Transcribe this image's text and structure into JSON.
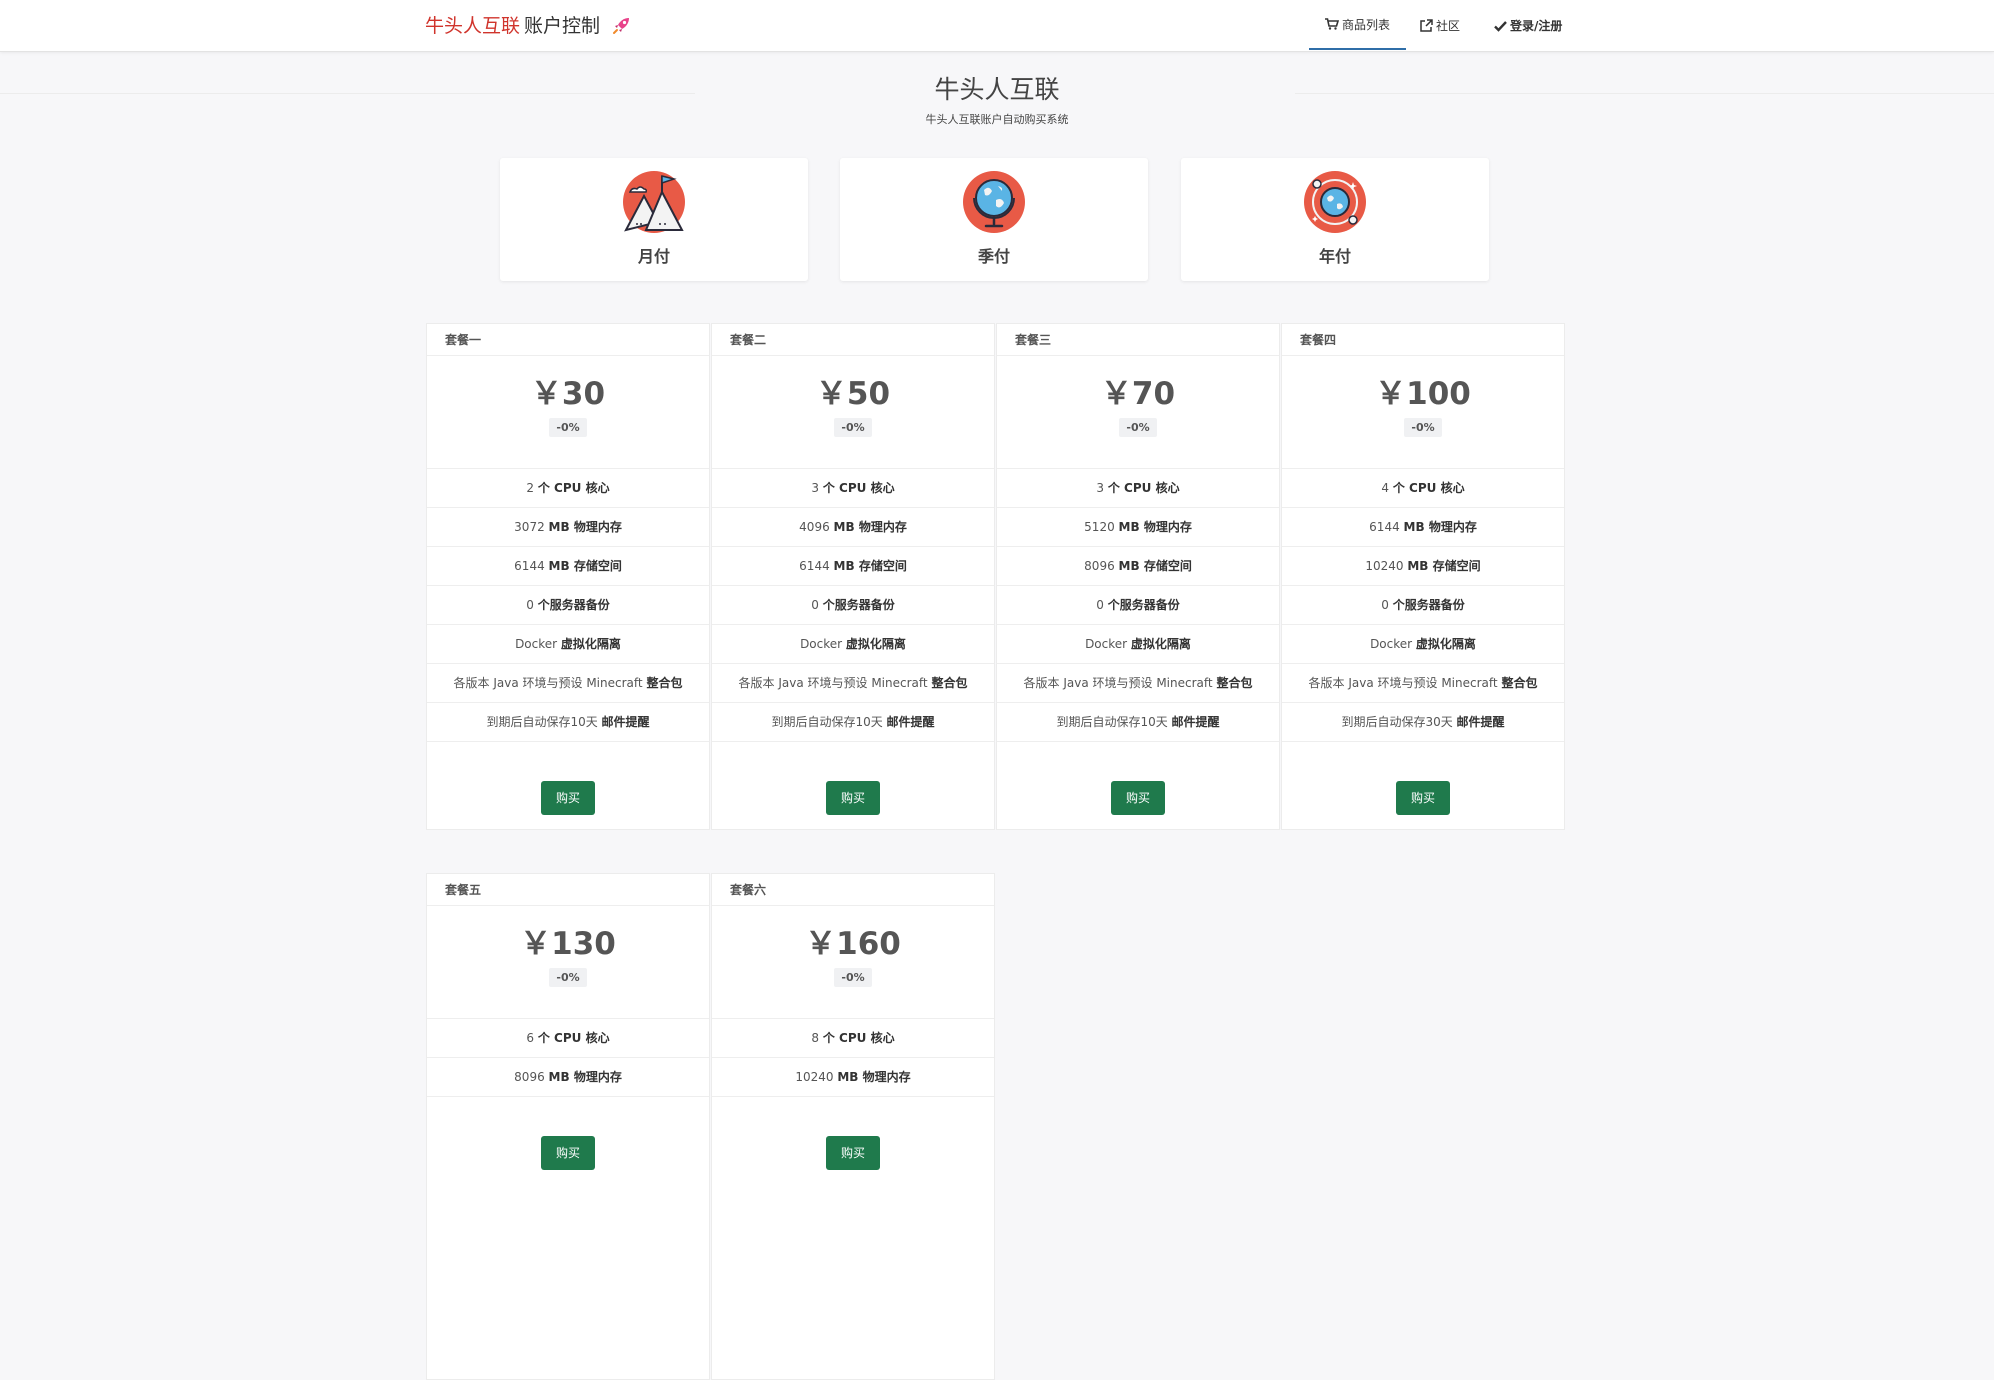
{
  "brand": {
    "name": "牛头人互联",
    "suffix": "账户控制",
    "icon": "rocket-icon",
    "color": "#d0342c"
  },
  "nav": {
    "items": [
      {
        "label": "商品列表",
        "icon": "shopping-cart-icon",
        "active": true
      },
      {
        "label": "社区",
        "icon": "external-link-icon",
        "active": false
      },
      {
        "label": "登录/注册",
        "icon": "check-icon",
        "active": false
      }
    ],
    "active_color": "#2f6ea8"
  },
  "hero": {
    "title": "牛头人互联",
    "subtitle": "牛头人互联账户自动购买系统"
  },
  "periods": [
    {
      "label": "月付",
      "icon": "mountains-flag-icon"
    },
    {
      "label": "季付",
      "icon": "globe-stand-icon"
    },
    {
      "label": "年付",
      "icon": "globe-orbit-icon"
    }
  ],
  "buy_color": "#1f7a4c",
  "plans": [
    {
      "name": "套餐一",
      "price": "￥30",
      "discount": "-0%",
      "features": [
        {
          "value": "2",
          "text": "个 CPU 核心"
        },
        {
          "value": "3072",
          "text": "MB 物理内存"
        },
        {
          "value": "6144",
          "text": "MB 存储空间"
        },
        {
          "value": "0",
          "text": "个服务器备份"
        },
        {
          "value": "Docker",
          "text": "虚拟化隔离"
        },
        {
          "value": "各版本 Java 环境与预设 Minecraft",
          "text": "整合包"
        },
        {
          "value": "到期后自动保存10天",
          "text": "邮件提醒"
        }
      ],
      "buy": "购买"
    },
    {
      "name": "套餐二",
      "price": "￥50",
      "discount": "-0%",
      "features": [
        {
          "value": "3",
          "text": "个 CPU 核心"
        },
        {
          "value": "4096",
          "text": "MB 物理内存"
        },
        {
          "value": "6144",
          "text": "MB 存储空间"
        },
        {
          "value": "0",
          "text": "个服务器备份"
        },
        {
          "value": "Docker",
          "text": "虚拟化隔离"
        },
        {
          "value": "各版本 Java 环境与预设 Minecraft",
          "text": "整合包"
        },
        {
          "value": "到期后自动保存10天",
          "text": "邮件提醒"
        }
      ],
      "buy": "购买"
    },
    {
      "name": "套餐三",
      "price": "￥70",
      "discount": "-0%",
      "features": [
        {
          "value": "3",
          "text": "个 CPU 核心"
        },
        {
          "value": "5120",
          "text": "MB 物理内存"
        },
        {
          "value": "8096",
          "text": "MB 存储空间"
        },
        {
          "value": "0",
          "text": "个服务器备份"
        },
        {
          "value": "Docker",
          "text": "虚拟化隔离"
        },
        {
          "value": "各版本 Java 环境与预设 Minecraft",
          "text": "整合包"
        },
        {
          "value": "到期后自动保存10天",
          "text": "邮件提醒"
        }
      ],
      "buy": "购买"
    },
    {
      "name": "套餐四",
      "price": "￥100",
      "discount": "-0%",
      "features": [
        {
          "value": "4",
          "text": "个 CPU 核心"
        },
        {
          "value": "6144",
          "text": "MB 物理内存"
        },
        {
          "value": "10240",
          "text": "MB 存储空间"
        },
        {
          "value": "0",
          "text": "个服务器备份"
        },
        {
          "value": "Docker",
          "text": "虚拟化隔离"
        },
        {
          "value": "各版本 Java 环境与预设 Minecraft",
          "text": "整合包"
        },
        {
          "value": "到期后自动保存30天",
          "text": "邮件提醒"
        }
      ],
      "buy": "购买"
    },
    {
      "name": "套餐五",
      "price": "￥130",
      "discount": "-0%",
      "features": [
        {
          "value": "6",
          "text": "个 CPU 核心"
        },
        {
          "value": "8096",
          "text": "MB 物理内存"
        }
      ],
      "buy": "购买"
    },
    {
      "name": "套餐六",
      "price": "￥160",
      "discount": "-0%",
      "features": [
        {
          "value": "8",
          "text": "个 CPU 核心"
        },
        {
          "value": "10240",
          "text": "MB 物理内存"
        }
      ],
      "buy": "购买"
    }
  ]
}
